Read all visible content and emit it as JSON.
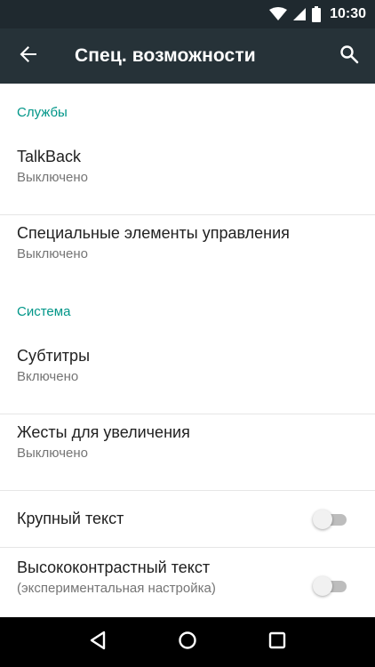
{
  "status_bar": {
    "time": "10:30",
    "icons": [
      "wifi-icon",
      "cell-signal-icon",
      "battery-icon"
    ]
  },
  "toolbar": {
    "title": "Спец. возможности",
    "back_icon": "arrow-back-icon",
    "search_icon": "search-icon"
  },
  "sections": {
    "services": {
      "header": "Службы",
      "items": [
        {
          "title": "TalkBack",
          "summary": "Выключено"
        },
        {
          "title": "Специальные элементы управления",
          "summary": "Выключено"
        }
      ]
    },
    "system": {
      "header": "Система",
      "items": [
        {
          "title": "Субтитры",
          "summary": "Включено"
        },
        {
          "title": "Жесты для увеличения",
          "summary": "Выключено"
        },
        {
          "title": "Крупный текст",
          "switch_on": false
        },
        {
          "title": "Высококонтрастный текст",
          "summary": "(экспериментальная настройка)",
          "switch_on": false
        }
      ]
    }
  },
  "nav_bar": {
    "icons": [
      "back-triangle-icon",
      "home-circle-icon",
      "recents-square-icon"
    ]
  },
  "colors": {
    "status_bar": "#1f292f",
    "toolbar": "#263238",
    "accent": "#009688",
    "nav_bar": "#000000"
  }
}
